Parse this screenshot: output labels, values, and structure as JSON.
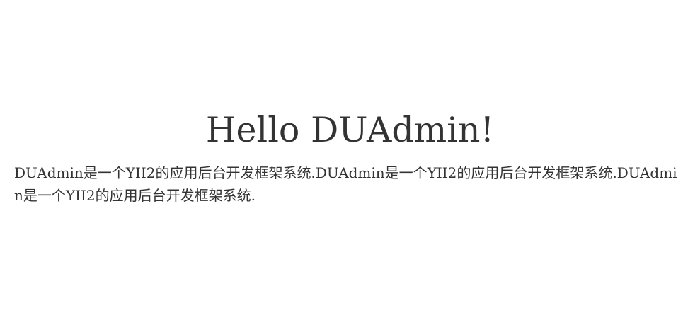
{
  "hero": {
    "title": "Hello DUAdmin!",
    "description": "DUAdmin是一个YII2的应用后台开发框架系统.DUAdmin是一个YII2的应用后台开发框架系统.DUAdmin是一个YII2的应用后台开发框架系统."
  },
  "colors": {
    "background": "#ffffff",
    "text": "#333333"
  }
}
